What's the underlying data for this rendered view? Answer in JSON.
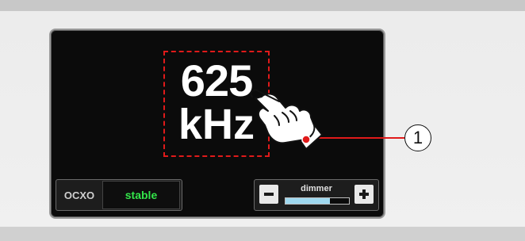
{
  "display": {
    "frequency_value": "625",
    "frequency_unit": "kHz"
  },
  "ocxo": {
    "label": "OCXO",
    "status": "stable",
    "status_color": "#33e64a"
  },
  "dimmer": {
    "label": "dimmer",
    "level": 0.7,
    "fill_color": "#9fd8ef"
  },
  "callout": {
    "number": "1",
    "line_color": "#e01a1a"
  },
  "icons": {
    "pointer": "hand-pointer-icon",
    "minus": "minus-icon",
    "plus": "plus-icon"
  }
}
